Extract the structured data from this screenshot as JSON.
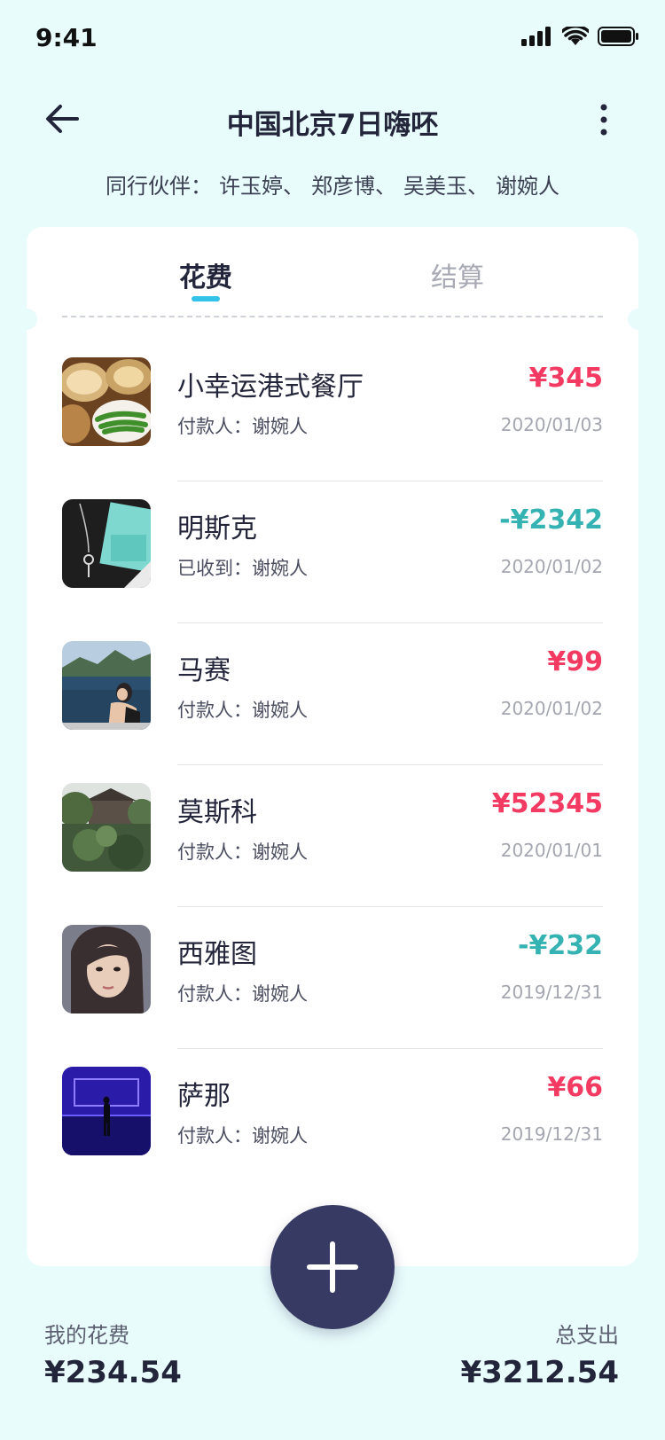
{
  "status_bar": {
    "time": "9:41",
    "icons": [
      "signal-icon",
      "wifi-icon",
      "battery-icon"
    ]
  },
  "header": {
    "title": "中国北京7日嗨呸",
    "companions_label": "同行伙伴：",
    "companions": [
      "许玉婷、",
      "郑彦博、",
      "吴美玉、",
      "谢婉人"
    ]
  },
  "tabs": [
    {
      "label": "花费",
      "active": true
    },
    {
      "label": "结算",
      "active": false
    }
  ],
  "expenses": [
    {
      "name": "小幸运港式餐厅",
      "payer": "付款人：谢婉人",
      "amount": "¥345",
      "type": "pos",
      "date": "2020/01/03",
      "thumb": "dim-sum-photo"
    },
    {
      "name": "明斯克",
      "payer": "已收到：谢婉人",
      "amount": "-¥2342",
      "type": "neg",
      "date": "2020/01/02",
      "thumb": "jewelry-box-photo"
    },
    {
      "name": "马赛",
      "payer": "付款人：谢婉人",
      "amount": "¥99",
      "type": "pos",
      "date": "2020/01/02",
      "thumb": "lake-portrait-photo"
    },
    {
      "name": "莫斯科",
      "payer": "付款人：谢婉人",
      "amount": "¥52345",
      "type": "pos",
      "date": "2020/01/01",
      "thumb": "garden-house-photo"
    },
    {
      "name": "西雅图",
      "payer": "付款人：谢婉人",
      "amount": "-¥232",
      "type": "neg",
      "date": "2019/12/31",
      "thumb": "portrait-photo"
    },
    {
      "name": "萨那",
      "payer": "付款人：谢婉人",
      "amount": "¥66",
      "type": "pos",
      "date": "2019/12/31",
      "thumb": "neon-room-photo"
    }
  ],
  "footer": {
    "my_label": "我的花费",
    "my_value": "¥234.54",
    "total_label": "总支出",
    "total_value": "¥3212.54"
  },
  "colors": {
    "background": "#e9fcfc",
    "positive": "#f23a62",
    "negative": "#35b3b2",
    "fab": "#373a62",
    "tab_indicator": "#33c2e8"
  }
}
